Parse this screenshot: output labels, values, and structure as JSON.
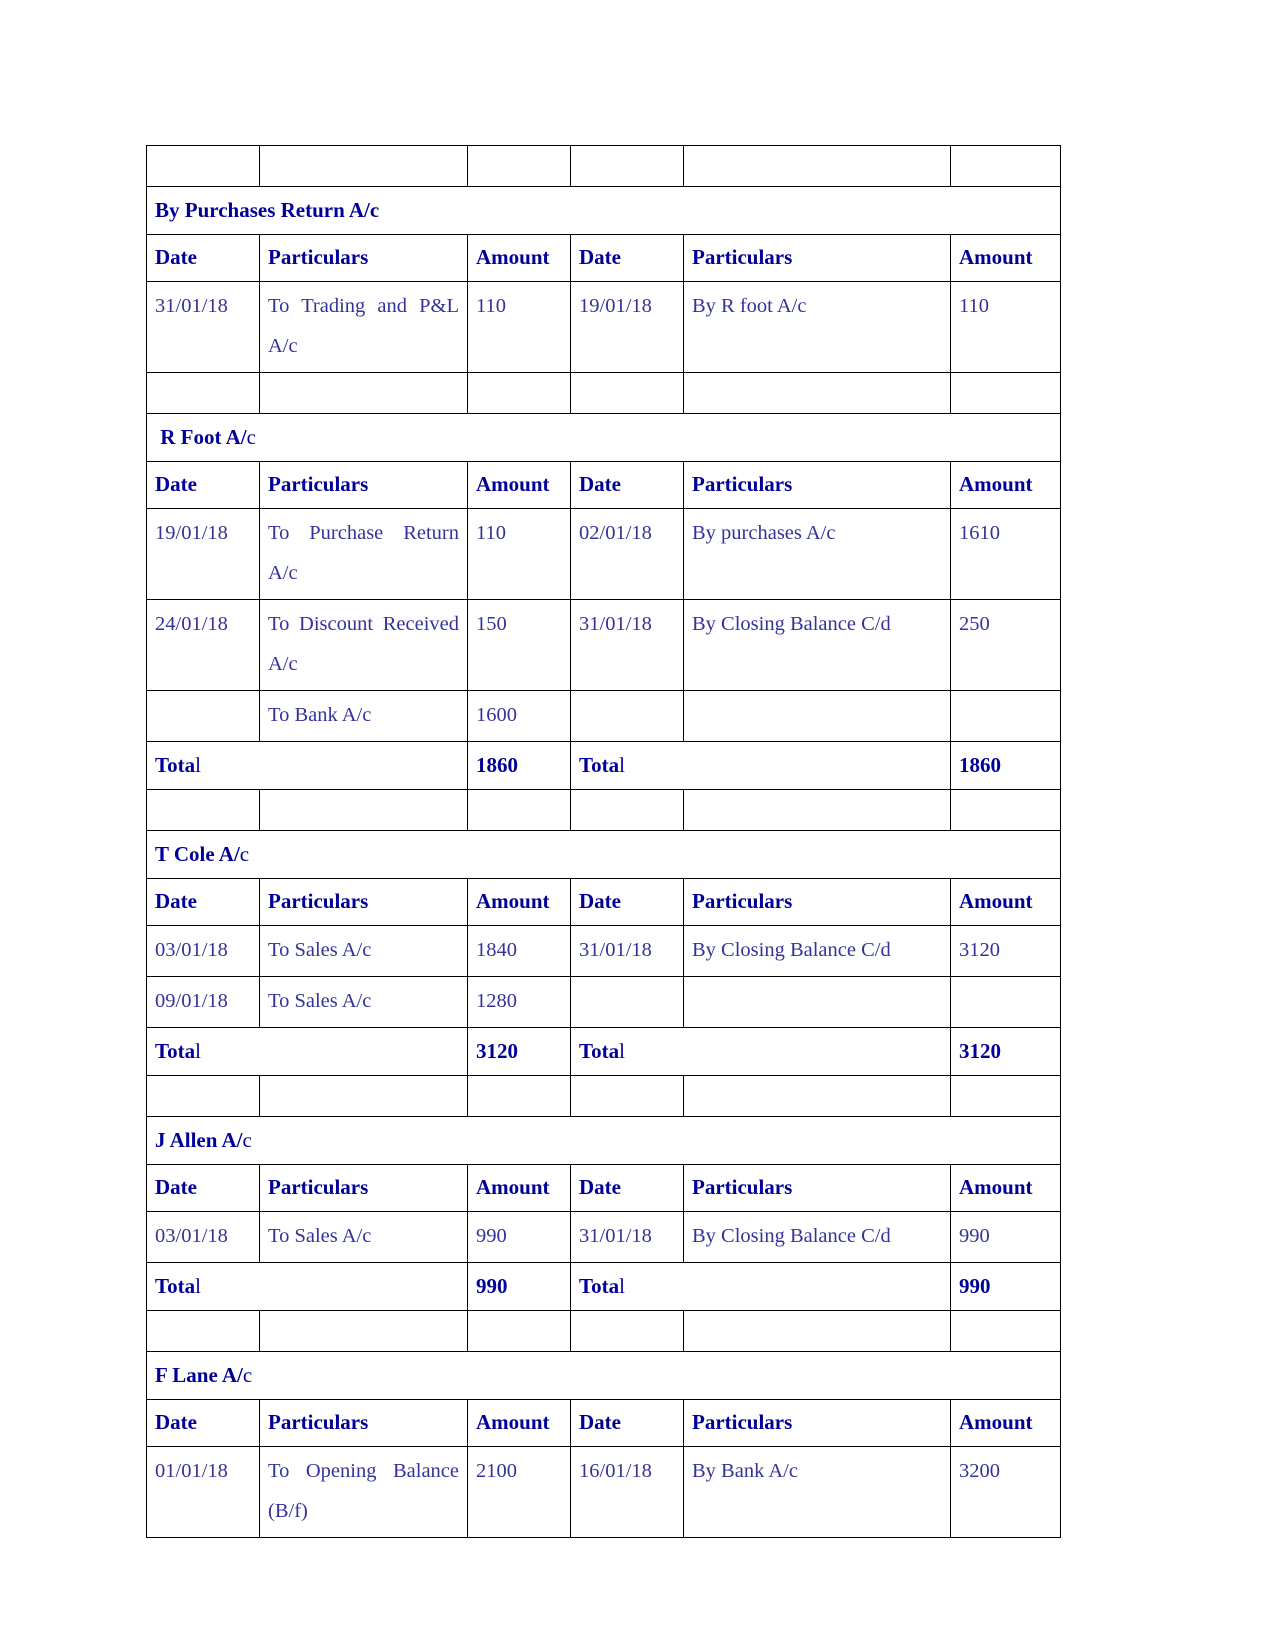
{
  "document": {
    "type": "ledger-accounts",
    "colors": {
      "heading": "#000099",
      "body": "#333399",
      "border": "#000000",
      "page": "#ffffff"
    }
  },
  "column_headers": {
    "date": "Date",
    "particulars": "Particulars",
    "amount": "Amount"
  },
  "labels": {
    "total_bold": "Tota",
    "total_thin": "l",
    "ac_bold": "A/",
    "ac_thin": "c"
  },
  "accounts": [
    {
      "id": "purchases-return",
      "title_bold": "By Purchases Return A/c",
      "title_thin": "",
      "rows": [
        {
          "date1": "31/01/18",
          "particulars1": "To Trading and P&L A/c",
          "particulars1_justify": true,
          "amount1": "110",
          "date2": "19/01/18",
          "particulars2": "By R foot A/c",
          "amount2": "110",
          "tall": true
        }
      ],
      "total": null
    },
    {
      "id": "r-foot",
      "title_bold": " R Foot A/",
      "title_thin": "c",
      "rows": [
        {
          "date1": "19/01/18",
          "particulars1": "To Purchase Return A/c",
          "particulars1_justify": true,
          "amount1": "110",
          "date2": "02/01/18",
          "particulars2": "By purchases A/c",
          "amount2": "1610",
          "tall": true
        },
        {
          "date1": "24/01/18",
          "particulars1": "To Discount Received A/c",
          "particulars1_justify": true,
          "amount1": "150",
          "date2": "31/01/18",
          "particulars2": "By Closing Balance C/d",
          "amount2": "250",
          "tall": true
        },
        {
          "date1": "",
          "particulars1": "To Bank A/c",
          "particulars1_justify": false,
          "amount1": "1600",
          "date2": "",
          "particulars2": "",
          "amount2": "",
          "tall": false
        }
      ],
      "total": {
        "left_amount": "1860",
        "right_amount": "1860"
      }
    },
    {
      "id": "t-cole",
      "title_bold": "T Cole A/",
      "title_thin": "c",
      "rows": [
        {
          "date1": "03/01/18",
          "particulars1": "To Sales A/c",
          "particulars1_justify": false,
          "amount1": "1840",
          "date2": "31/01/18",
          "particulars2": "By Closing Balance C/d",
          "amount2": "3120",
          "tall": false
        },
        {
          "date1": "09/01/18",
          "particulars1": "To Sales A/c",
          "particulars1_justify": false,
          "amount1": "1280",
          "date2": "",
          "particulars2": "",
          "amount2": "",
          "tall": false
        }
      ],
      "total": {
        "left_amount": "3120",
        "right_amount": "3120"
      }
    },
    {
      "id": "j-allen",
      "title_bold": "J Allen A/",
      "title_thin": "c",
      "rows": [
        {
          "date1": "03/01/18",
          "particulars1": "To Sales A/c",
          "particulars1_justify": false,
          "amount1": "990",
          "date2": "31/01/18",
          "particulars2": "By Closing Balance C/d",
          "amount2": "990",
          "tall": false
        }
      ],
      "total": {
        "left_amount": "990",
        "right_amount": "990"
      }
    },
    {
      "id": "f-lane",
      "title_bold": "F Lane A/",
      "title_thin": "c",
      "rows": [
        {
          "date1": "01/01/18",
          "particulars1": "To Opening Balance (B/f)",
          "particulars1_justify": true,
          "amount1": "2100",
          "date2": "16/01/18",
          "particulars2": "By Bank A/c",
          "amount2": "3200",
          "tall": true
        }
      ],
      "total": null
    }
  ]
}
